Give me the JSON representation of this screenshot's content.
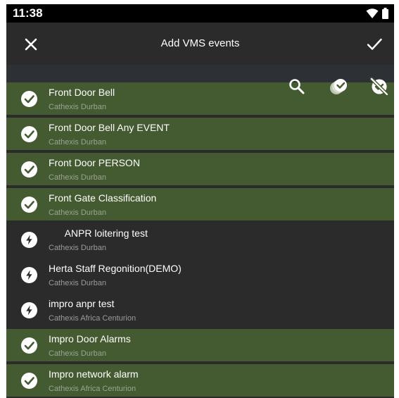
{
  "status_bar": {
    "time": "11:38",
    "icons": [
      "wifi-icon",
      "battery-icon"
    ]
  },
  "app_bar": {
    "title": "Add VMS events",
    "close_icon": "close-icon",
    "confirm_icon": "check-icon"
  },
  "toolbar": {
    "icons": [
      "search-icon",
      "select-all-icon",
      "deselect-all-icon"
    ]
  },
  "colors": {
    "selected_row": "#445a31",
    "unselected_row": "#2b2b2b",
    "app_bar": "#2b2b2b",
    "status_bar": "#000000"
  },
  "events": [
    {
      "title": "Front Door Bell",
      "site": "Cathexis Durban",
      "selected": true,
      "icon": "check-circle-icon"
    },
    {
      "title": "Front Door Bell Any EVENT",
      "site": "Cathexis Durban",
      "selected": true,
      "icon": "check-circle-icon"
    },
    {
      "title": "Front Door PERSON",
      "site": "Cathexis Durban",
      "selected": true,
      "icon": "check-circle-icon"
    },
    {
      "title": "Front Gate Classification",
      "site": "Cathexis Durban",
      "selected": true,
      "icon": "check-circle-icon"
    },
    {
      "title": "      ANPR loitering test",
      "site": "Cathexis Durban",
      "selected": false,
      "icon": "lightning-circle-icon"
    },
    {
      "title": "Herta Staff Regonition(DEMO)",
      "site": "Cathexis Durban",
      "selected": false,
      "icon": "lightning-circle-icon"
    },
    {
      "title": "impro anpr test",
      "site": "Cathexis Africa Centurion",
      "selected": false,
      "icon": "lightning-circle-icon"
    },
    {
      "title": "Impro Door Alarms",
      "site": "Cathexis Durban",
      "selected": true,
      "icon": "check-circle-icon"
    },
    {
      "title": "Impro network alarm",
      "site": "Cathexis Africa Centurion",
      "selected": true,
      "icon": "check-circle-icon"
    }
  ]
}
